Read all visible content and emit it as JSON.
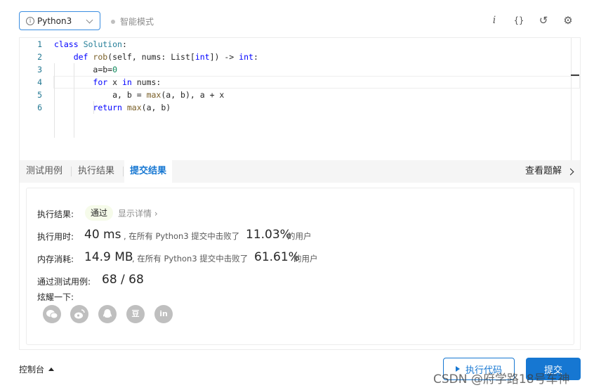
{
  "toolbar": {
    "language": "Python3",
    "smart_mode": "智能模式",
    "info_glyph": "i",
    "format_glyph": "{}",
    "reset_glyph": "↺",
    "settings_glyph": "⚙"
  },
  "editor": {
    "line_numbers": [
      "1",
      "2",
      "3",
      "4",
      "5",
      "6"
    ],
    "lines": {
      "l1": {
        "kw": "class",
        "rest": " ",
        "cls": "Solution",
        "tail": ":"
      },
      "l2": {
        "indent": "    ",
        "kw": "def",
        "sp": " ",
        "fn": "rob",
        "a": "(self, nums: List[",
        "t1": "int",
        "b": "]) -> ",
        "t2": "int",
        "c": ":"
      },
      "l3": {
        "indent": "        ",
        "text": "a=b=",
        "num": "0"
      },
      "l4": {
        "indent": "        ",
        "kw1": "for",
        "mid": " x ",
        "kw2": "in",
        "tail": " nums:"
      },
      "l5": {
        "indent": "            ",
        "a": "a, b = ",
        "fn": "max",
        "b": "(a, b), a + x"
      },
      "l6": {
        "indent": "        ",
        "kw": "return",
        "sp": " ",
        "fn": "max",
        "tail": "(a, b)"
      }
    }
  },
  "tabs": {
    "test_cases": "测试用例",
    "run_result": "执行结果",
    "submit_result": "提交结果",
    "view_solution": "查看题解"
  },
  "result": {
    "exec_label": "执行结果:",
    "status": "通过",
    "details": "显示详情",
    "details_arrow": "›",
    "time_label": "执行用时:",
    "time_value": "40 ms",
    "time_mid": ", 在所有 Python3 提交中击败了",
    "time_pct": "11.03%",
    "time_suffix": "的用户",
    "mem_label": "内存消耗:",
    "mem_value": "14.9 MB",
    "mem_mid": ", 在所有 Python3 提交中击败了",
    "mem_pct": "61.61%",
    "mem_suffix": "的用户",
    "cases_label": "通过测试用例:",
    "cases_value": "68 / 68",
    "share_label": "炫耀一下:",
    "share_icons": [
      "wechat-icon",
      "weibo-icon",
      "qq-icon",
      "douban-icon",
      "linkedin-icon"
    ],
    "douban_glyph": "豆",
    "linkedin_glyph": "in"
  },
  "footer": {
    "console": "控制台",
    "run_code": "执行代码",
    "submit": "提交"
  },
  "watermark": "CSDN @府学路18号车神",
  "colors": {
    "accent": "#1677d2",
    "pass_bg": "#f6fbea",
    "keyword": "#0000ff",
    "function": "#795e26",
    "type": "#267f99",
    "number": "#098658"
  }
}
